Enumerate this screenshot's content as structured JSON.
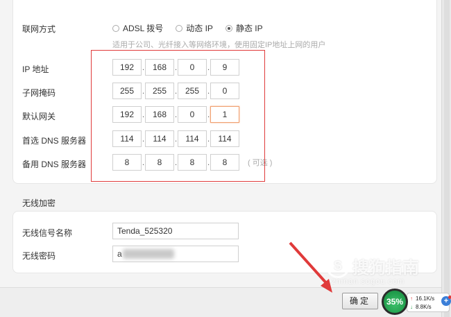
{
  "connection": {
    "label": "联网方式",
    "options": [
      {
        "label": "ADSL 拨号",
        "checked": false
      },
      {
        "label": "动态 IP",
        "checked": false
      },
      {
        "label": "静态 IP",
        "checked": true
      }
    ],
    "hint": "适用于公司、光纤接入等网络环境，使用固定IP地址上网的用户"
  },
  "fields": {
    "ip": {
      "label": "IP 地址",
      "octets": [
        "192",
        "168",
        "0",
        "9"
      ]
    },
    "mask": {
      "label": "子网掩码",
      "octets": [
        "255",
        "255",
        "255",
        "0"
      ]
    },
    "gateway": {
      "label": "默认网关",
      "octets": [
        "192",
        "168",
        "0",
        "1"
      ]
    },
    "dns1": {
      "label": "首选 DNS 服务器",
      "octets": [
        "114",
        "114",
        "114",
        "114"
      ]
    },
    "dns2": {
      "label": "备用 DNS 服务器",
      "octets": [
        "8",
        "8",
        "8",
        "8"
      ],
      "optional": "( 可选 )"
    }
  },
  "wireless": {
    "section_title": "无线加密",
    "ssid_label": "无线信号名称",
    "ssid_value": "Tenda_525320",
    "password_label": "无线密码",
    "password_value": "a"
  },
  "footer": {
    "ok_label": "确定"
  },
  "watermark": {
    "text": "搜狗指南",
    "sub": "zhinan.sogou.com",
    "logo": "S"
  },
  "speed": {
    "cpu": "35%",
    "up": "16.1K/s",
    "down": "8.8K/s"
  },
  "colors": {
    "highlight_frame": "#e03a3a",
    "focus_border": "#f0a070",
    "arrow": "#e03a3a"
  }
}
